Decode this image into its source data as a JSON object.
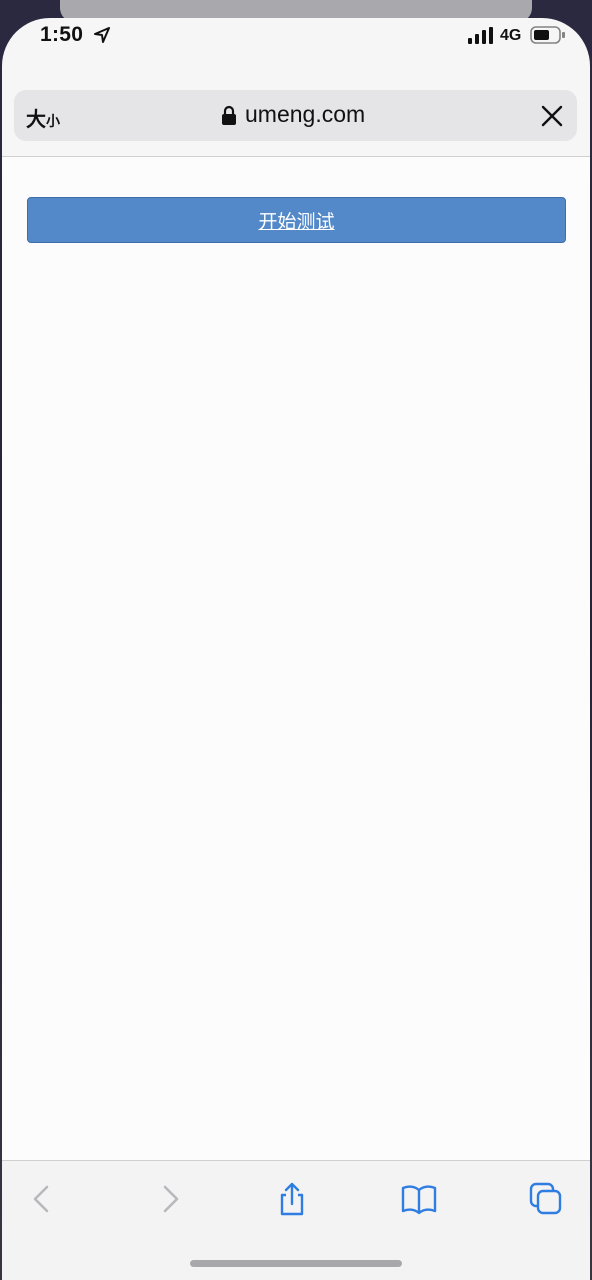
{
  "status_bar": {
    "time": "1:50",
    "network": "4G"
  },
  "url_bar": {
    "text_size_big": "大",
    "text_size_small": "小",
    "domain": "umeng.com"
  },
  "page": {
    "start_button_label": "开始测试"
  },
  "colors": {
    "button": "#5389c8",
    "toolbar_icon": "#2f7de1",
    "toolbar_icon_disabled": "#b9b9bd"
  },
  "icons": {
    "back": "chevron-left-icon",
    "forward": "chevron-right-icon",
    "share": "share-icon",
    "bookmarks": "book-icon",
    "tabs": "tabs-icon"
  }
}
